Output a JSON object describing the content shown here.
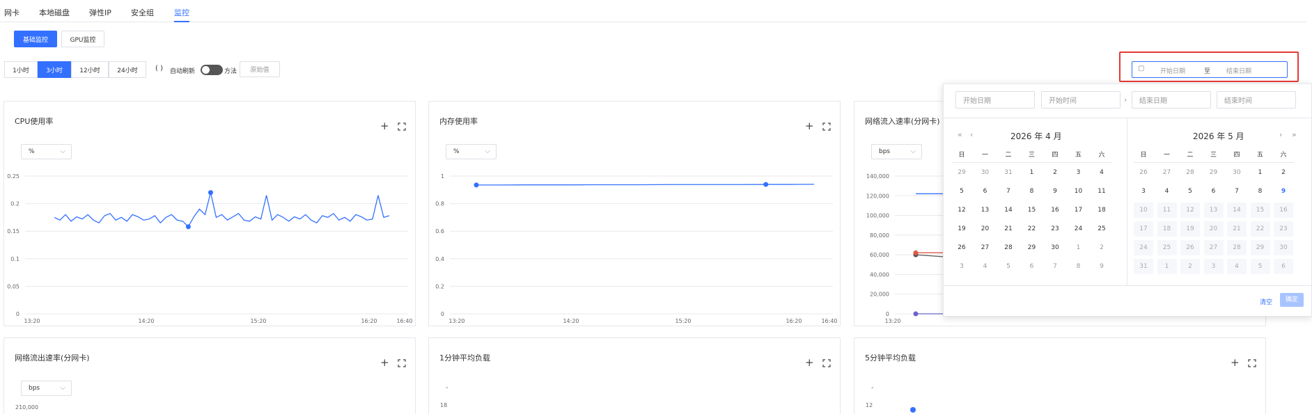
{
  "tabs": [
    "网卡",
    "本地磁盘",
    "弹性IP",
    "安全组",
    "监控"
  ],
  "monitor_types": {
    "basic": "基础监控",
    "gpu": "GPU监控"
  },
  "ranges": [
    "1小时",
    "3小时",
    "12小时",
    "24小时"
  ],
  "toolbar": {
    "refresh_icon": "( )",
    "auto_refresh": "自动刷新",
    "method": "方法",
    "method_placeholder": "原始值"
  },
  "date_range": {
    "start_placeholder": "开始日期",
    "end_placeholder": "结束日期",
    "separator": "至"
  },
  "picker": {
    "start_date": "开始日期",
    "start_time": "开始时间",
    "end_date": "结束日期",
    "end_time": "结束时间",
    "left_title": "2026 年 4 月",
    "right_title": "2026 年 5 月",
    "weekdays": [
      "日",
      "一",
      "二",
      "三",
      "四",
      "五",
      "六"
    ],
    "left_days": [
      "29",
      "30",
      "31",
      "1",
      "2",
      "3",
      "4",
      "5",
      "6",
      "7",
      "8",
      "9",
      "10",
      "11",
      "12",
      "13",
      "14",
      "15",
      "16",
      "17",
      "18",
      "19",
      "20",
      "21",
      "22",
      "23",
      "24",
      "25",
      "26",
      "27",
      "28",
      "29",
      "30",
      "1",
      "2",
      "3",
      "4",
      "5",
      "6",
      "7",
      "8",
      "9"
    ],
    "right_days": [
      "26",
      "27",
      "28",
      "29",
      "30",
      "1",
      "2",
      "3",
      "4",
      "5",
      "6",
      "7",
      "8",
      "9",
      "10",
      "11",
      "12",
      "13",
      "14",
      "15",
      "16",
      "17",
      "18",
      "19",
      "20",
      "21",
      "22",
      "23",
      "24",
      "25",
      "26",
      "27",
      "28",
      "29",
      "30",
      "31",
      "1",
      "2",
      "3",
      "4",
      "5",
      "6"
    ],
    "clear": "清空",
    "confirm": "确定",
    "prev_year": "«",
    "prev_month": "‹",
    "next_month": "›",
    "next_year": "»"
  },
  "panels": [
    {
      "title": "CPU使用率",
      "unit": "%"
    },
    {
      "title": "内存使用率",
      "unit": "%"
    },
    {
      "title": "网络流入速率(分网卡)",
      "unit": "bps"
    },
    {
      "title": "网络流出速率(分网卡)",
      "unit": "bps"
    },
    {
      "title": "1分钟平均负载",
      "unit": ""
    },
    {
      "title": "5分钟平均负载",
      "unit": ""
    }
  ],
  "colors": {
    "accent": "#3370ff",
    "series": "#3370ff",
    "grid": "#e8e8e8",
    "highlight_border": "#e53935"
  },
  "chart_data": [
    {
      "type": "line",
      "title": "CPU使用率",
      "x": [
        "13:20",
        "14:20",
        "15:20",
        "16:20",
        "16:40"
      ],
      "yticks": [
        "0",
        "0.05",
        "0.1",
        "0.15",
        "0.2",
        "0.25"
      ],
      "ylim": [
        0,
        0.25
      ],
      "series": [
        {
          "values": [
            0.175,
            0.17,
            0.18,
            0.168,
            0.176,
            0.172,
            0.18,
            0.17,
            0.165,
            0.178,
            0.182,
            0.17,
            0.175,
            0.168,
            0.18,
            0.176,
            0.17,
            0.172,
            0.178,
            0.165,
            0.175,
            0.18,
            0.17,
            0.168,
            0.158,
            0.176,
            0.19,
            0.18,
            0.22,
            0.175,
            0.18,
            0.17,
            0.176,
            0.182,
            0.17,
            0.168,
            0.176,
            0.172,
            0.215,
            0.17,
            0.18,
            0.175,
            0.168,
            0.176,
            0.172,
            0.18,
            0.17,
            0.165,
            0.178,
            0.175,
            0.182,
            0.17,
            0.175,
            0.168,
            0.18,
            0.176,
            0.17,
            0.172,
            0.215,
            0.175,
            0.178
          ]
        }
      ]
    },
    {
      "type": "line",
      "title": "内存使用率",
      "x": [
        "13:20",
        "14:20",
        "15:20",
        "16:20",
        "16:40"
      ],
      "yticks": [
        "0",
        "0.2",
        "0.4",
        "0.6",
        "0.8",
        "1"
      ],
      "ylim": [
        0,
        1
      ],
      "series": [
        {
          "values": [
            0.935,
            0.935,
            0.936,
            0.936,
            0.936,
            0.937,
            0.937,
            0.937,
            0.938,
            0.938,
            0.938,
            0.938,
            0.939,
            0.939,
            0.94
          ]
        }
      ]
    },
    {
      "type": "line",
      "title": "网络流入速率(分网卡)",
      "x": [
        "13:20"
      ],
      "yticks": [
        "0",
        "20,000",
        "40,000",
        "60,000",
        "80,000",
        "100,000",
        "120,000",
        "140,000"
      ],
      "ylim": [
        0,
        140000
      ],
      "series": [
        {
          "values": [
            122000,
            122000
          ]
        },
        {
          "values": [
            60000,
            58000
          ]
        },
        {
          "values": [
            62000,
            62000
          ]
        },
        {
          "values": [
            0,
            0
          ]
        }
      ]
    },
    {
      "type": "line",
      "title": "网络流出速率(分网卡)",
      "yticks": [
        "210,000"
      ]
    },
    {
      "type": "line",
      "title": "1分钟平均负载",
      "yticks": [
        "-",
        "18"
      ]
    },
    {
      "type": "line",
      "title": "5分钟平均负载",
      "yticks": [
        "-",
        "12"
      ]
    }
  ]
}
